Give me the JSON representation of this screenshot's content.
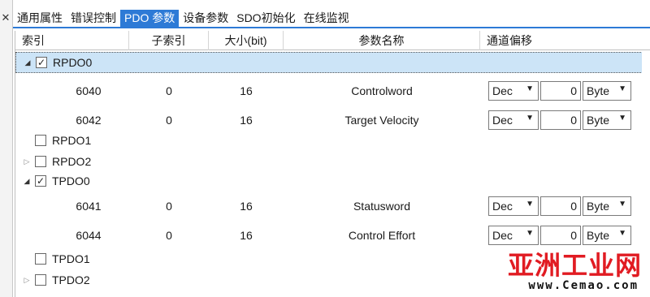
{
  "tabs": [
    "通用属性",
    "错误控制",
    "PDO 参数",
    "设备参数",
    "SDO初始化",
    "在线监视"
  ],
  "active_tab_index": 2,
  "columns": [
    "索引",
    "子索引",
    "大小(bit)",
    "参数名称",
    "通道偏移"
  ],
  "groups": {
    "rpdo0": {
      "label": "RPDO0",
      "checked": true,
      "expanded": true
    },
    "rpdo1": {
      "label": "RPDO1",
      "checked": false
    },
    "rpdo2": {
      "label": "RPDO2",
      "checked": false,
      "expandable": true
    },
    "tpdo0": {
      "label": "TPDO0",
      "checked": true,
      "expanded": true
    },
    "tpdo1": {
      "label": "TPDO1",
      "checked": false
    },
    "tpdo2": {
      "label": "TPDO2",
      "checked": false,
      "expandable": true
    }
  },
  "entries": [
    {
      "index": "6040",
      "subindex": "0",
      "size": "16",
      "name": "Controlword",
      "format": "Dec",
      "offset": "0",
      "unit": "Byte"
    },
    {
      "index": "6042",
      "subindex": "0",
      "size": "16",
      "name": "Target Velocity",
      "format": "Dec",
      "offset": "0",
      "unit": "Byte"
    },
    {
      "index": "6041",
      "subindex": "0",
      "size": "16",
      "name": "Statusword",
      "format": "Dec",
      "offset": "0",
      "unit": "Byte"
    },
    {
      "index": "6044",
      "subindex": "0",
      "size": "16",
      "name": "Control Effort",
      "format": "Dec",
      "offset": "0",
      "unit": "Byte"
    }
  ],
  "glyphs": {
    "checked": "✓",
    "expanded": "◢",
    "collapsed": "▷",
    "dropdown": "▼",
    "close": "✕"
  },
  "watermark": {
    "text": "亚洲工业网",
    "url": "www.Cemao.com"
  }
}
